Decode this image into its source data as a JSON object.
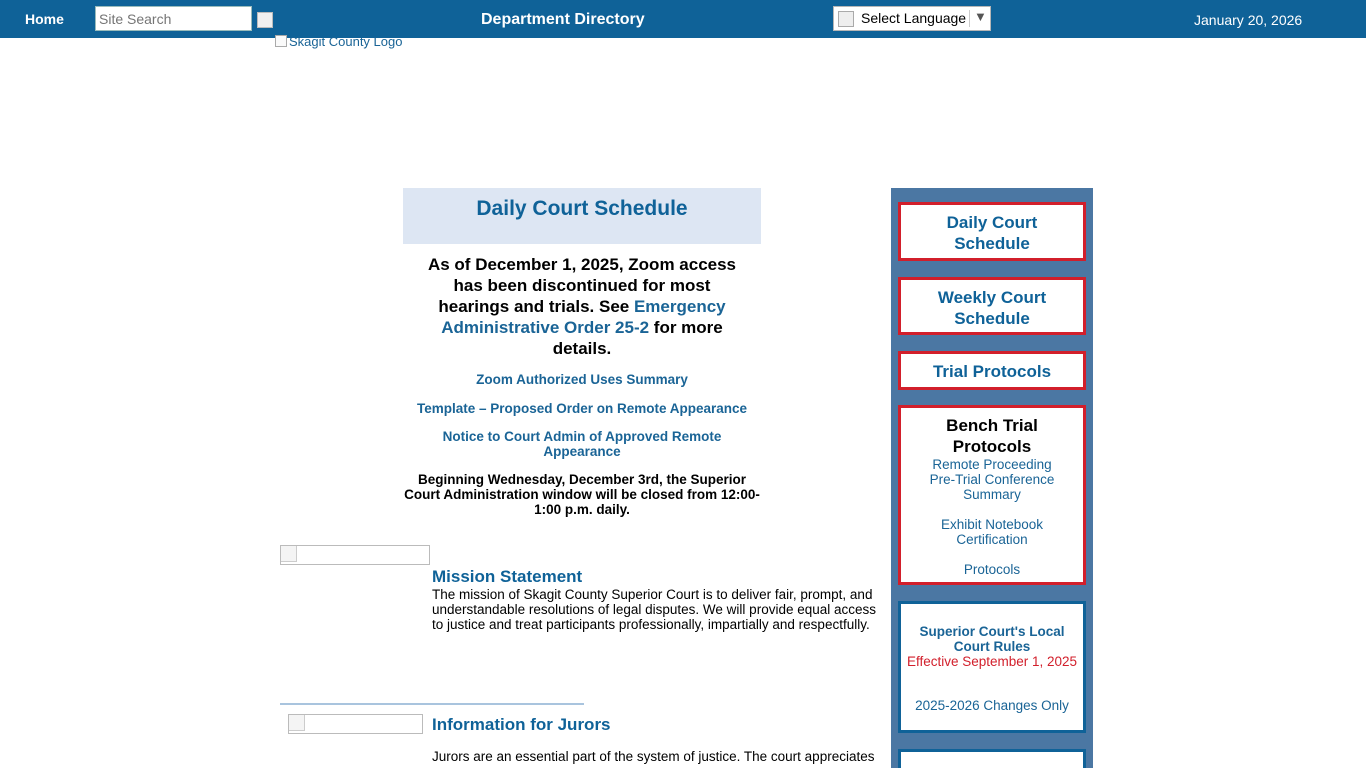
{
  "header": {
    "home_label": "Home",
    "search_placeholder": "Site Search",
    "dept_label": "Department Directory",
    "language_label": "Select Language",
    "language_arrow": "▼",
    "date": "January 20, 2026"
  },
  "logo": {
    "alt": "Skagit County Logo"
  },
  "main": {
    "schedule_title": "Daily Court Schedule",
    "notice": {
      "before": "As of December 1, 2025, Zoom access has been discontinued for most hearings and trials. See ",
      "link": "Emergency Administrative Order 25-2",
      "after": " for more details."
    },
    "links": [
      "Zoom Authorized Uses Summary",
      "Template – Proposed Order on Remote Appearance",
      "Notice to Court Admin of Approved Remote Appearance"
    ],
    "closed_notice": "Beginning Wednesday, December 3rd, the Superior Court Administration window will be closed from 12:00-1:00 p.m. daily.",
    "mission": {
      "title": "Mission Statement",
      "text": "The mission of Skagit County Superior Court is to deliver fair, prompt, and understandable resolutions of legal disputes. We will provide equal access to justice and treat participants professionally, impartially and respectfully."
    },
    "jurors": {
      "title": "Information for Jurors",
      "text": "Jurors are an essential part of the system of justice.  The court appreciates"
    }
  },
  "sidebar": {
    "daily": "Daily Court Schedule",
    "weekly": "Weekly Court Schedule",
    "trial": "Trial Protocols",
    "bench": {
      "title": "Bench Trial Protocols",
      "items": [
        "Remote Proceeding Pre-Trial Conference Summary",
        "Exhibit Notebook Certification",
        "Protocols"
      ]
    },
    "rules": {
      "title": "Superior Court's Local Court Rules",
      "effective": "Effective September 1, 2025",
      "changes": "2025-2026 Changes Only"
    }
  }
}
